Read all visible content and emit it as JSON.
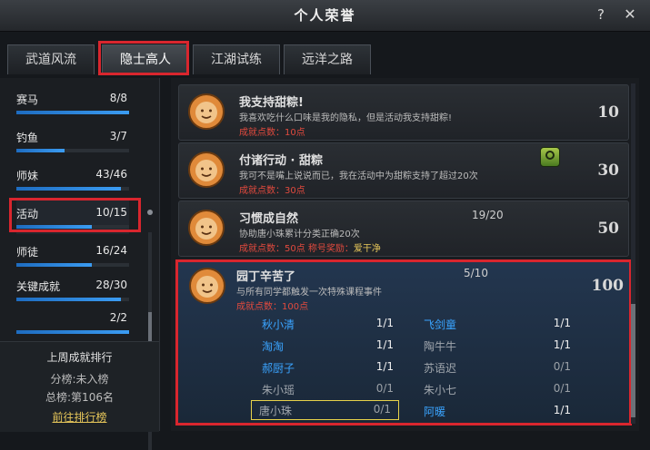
{
  "window": {
    "title": "个人荣誉",
    "help_label": "?",
    "close_label": "✕"
  },
  "tabs": [
    {
      "label": "武道风流",
      "active": false
    },
    {
      "label": "隐士高人",
      "active": true
    },
    {
      "label": "江湖试练",
      "active": false
    },
    {
      "label": "远洋之路",
      "active": false
    }
  ],
  "categories": [
    {
      "label": "赛马",
      "count": "8/8",
      "progress": 1.0
    },
    {
      "label": "钓鱼",
      "count": "3/7",
      "progress": 0.43
    },
    {
      "label": "师妹",
      "count": "43/46",
      "progress": 0.93
    },
    {
      "label": "活动",
      "count": "10/15",
      "progress": 0.67,
      "selected": true
    },
    {
      "label": "师徒",
      "count": "16/24",
      "progress": 0.67
    },
    {
      "label": "关键成就",
      "count": "28/30",
      "progress": 0.93
    },
    {
      "label": "",
      "count": "2/2",
      "progress": 1.0
    }
  ],
  "ranking": {
    "title": "上周成就排行",
    "line1": "分榜:未入榜",
    "line2": "总榜:第106名",
    "link": "前往排行榜"
  },
  "achievements": [
    {
      "name": "我支持甜粽!",
      "desc": "我喜欢吃什么口味是我的隐私，但是活动我支持甜粽!",
      "points": "成就点数：10点",
      "score": "10"
    },
    {
      "name": "付诸行动 · 甜粽",
      "desc": "我可不是嘴上说说而已，我在活动中为甜粽支持了超过20次",
      "points": "成就点数：30点",
      "score": "30"
    },
    {
      "name": "习惯成自然",
      "desc": "协助唐小珠累计分类正确20次",
      "points": "成就点数：50点 称号奖励：",
      "reward": "爱干净",
      "progress": "19/20",
      "score": "50"
    },
    {
      "name": "园丁辛苦了",
      "desc": "与所有同学都触发一次特殊课程事件",
      "points": "成就点数：100点",
      "progress": "5/10",
      "score": "100"
    }
  ],
  "details_left": [
    {
      "name": "秋小清",
      "value": "1/1",
      "done": true
    },
    {
      "name": "淘淘",
      "value": "1/1",
      "done": true
    },
    {
      "name": "郝厨子",
      "value": "1/1",
      "done": true
    },
    {
      "name": "朱小瑶",
      "value": "0/1",
      "done": false
    },
    {
      "name": "唐小珠",
      "value": "0/1",
      "done": false,
      "highlight": true
    }
  ],
  "details_right": [
    {
      "name": "飞剑童",
      "value": "1/1",
      "done": true
    },
    {
      "name": "陶牛牛",
      "value": "1/1",
      "done": false
    },
    {
      "name": "苏语迟",
      "value": "0/1",
      "done": false
    },
    {
      "name": "朱小七",
      "value": "0/1",
      "done": false
    },
    {
      "name": "阿暖",
      "value": "1/1",
      "done": true
    }
  ],
  "colors": {
    "accent": "#3aa4ff",
    "points": "#e24a3e",
    "highlight_red": "#d9262e"
  }
}
